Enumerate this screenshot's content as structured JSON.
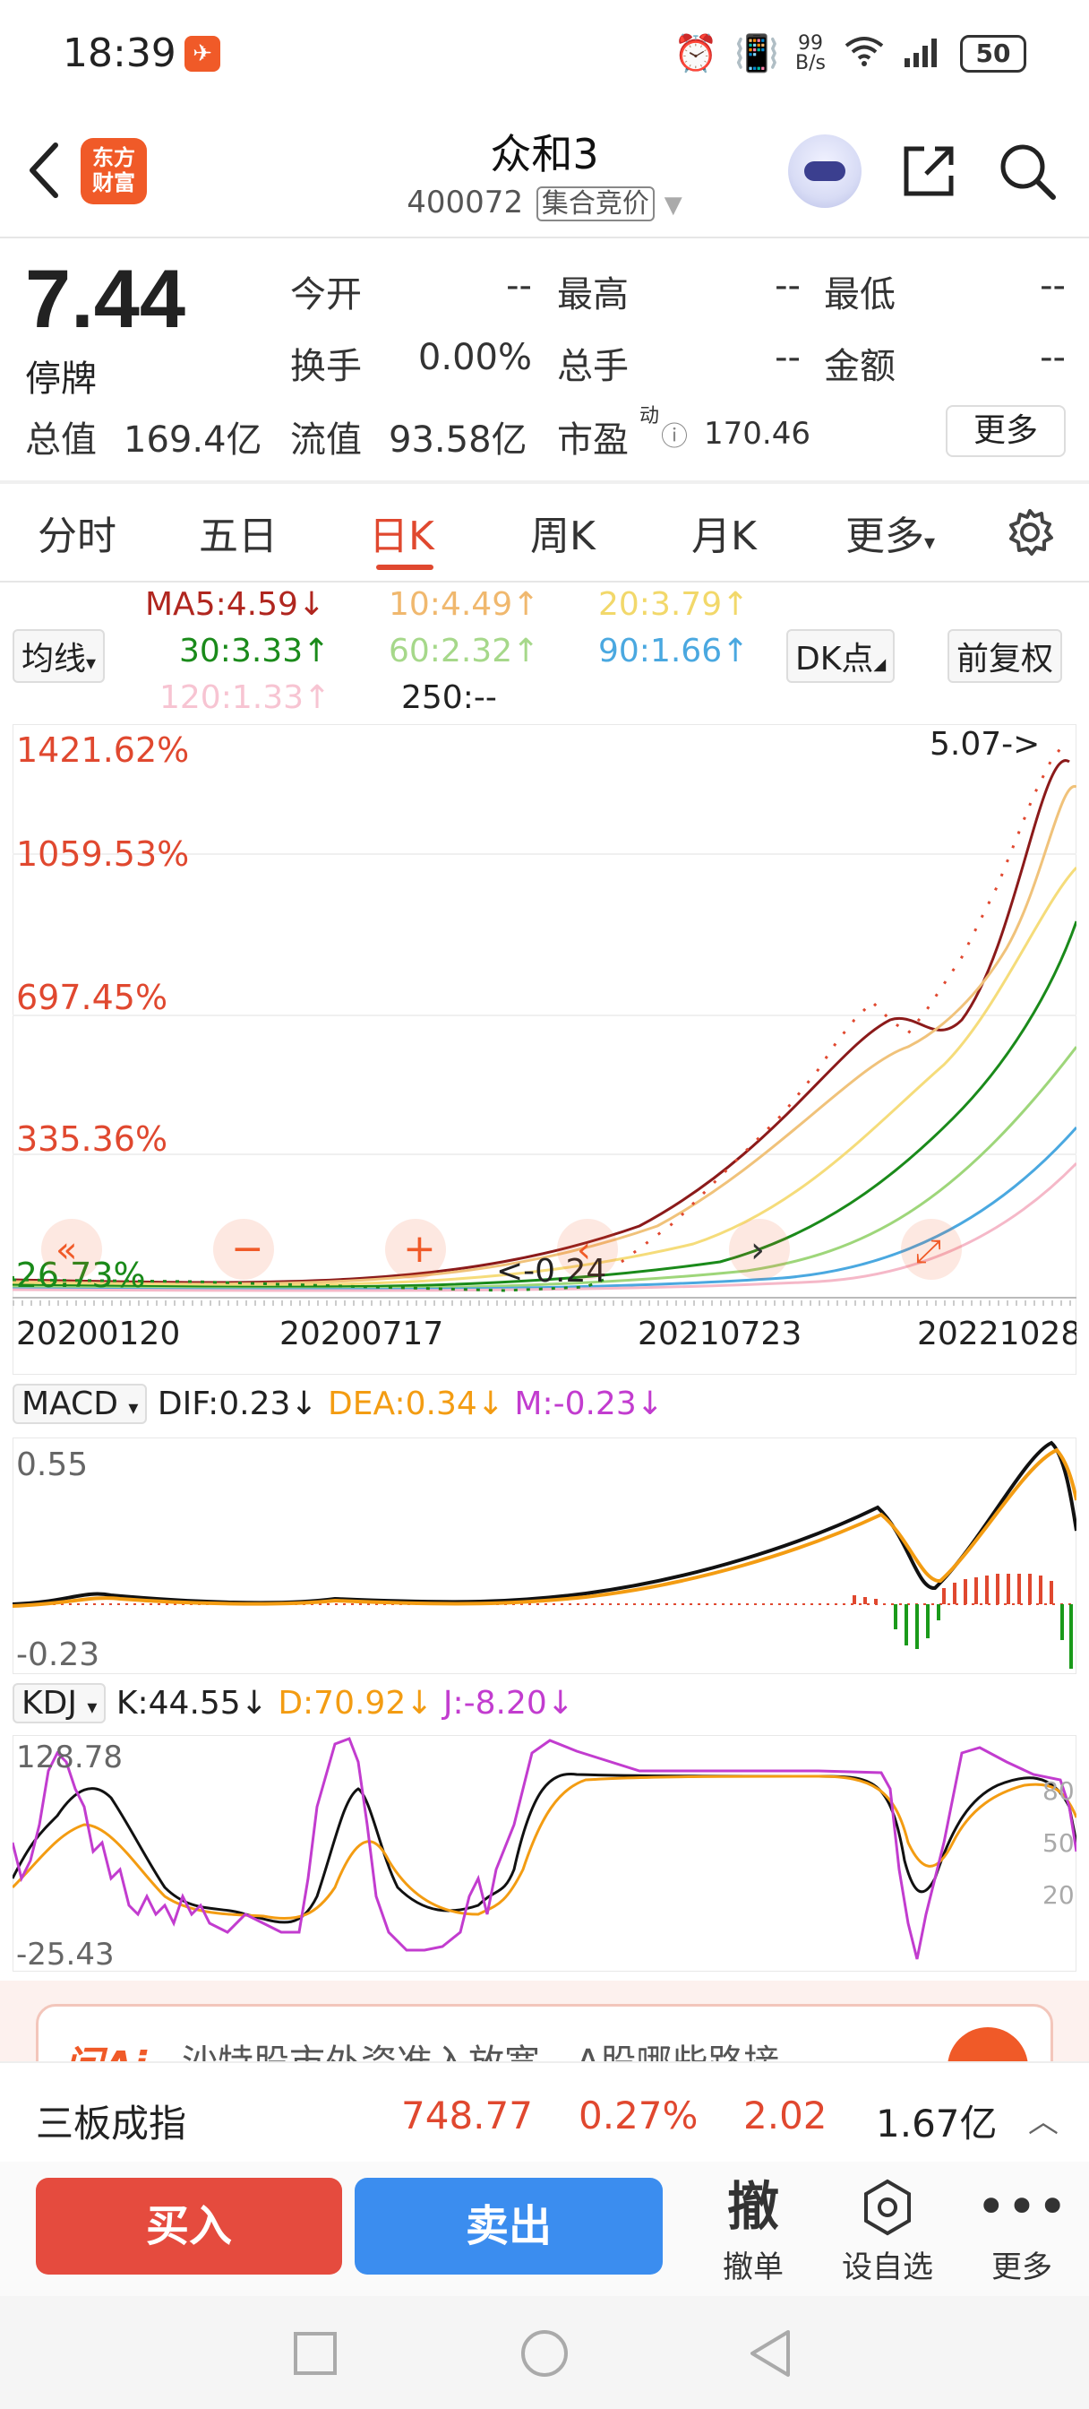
{
  "status_bar": {
    "time": "18:39",
    "net_speed_top": "99",
    "net_speed_bottom": "B/s",
    "battery": "50"
  },
  "header": {
    "stock_name": "众和3",
    "stock_code": "400072",
    "auction_tag": "集合竞价",
    "logo_text_line1": "东方",
    "logo_text_line2": "财富"
  },
  "quote": {
    "price": "7.44",
    "status": "停牌",
    "fields": [
      {
        "label": "今开",
        "value": "--"
      },
      {
        "label": "最高",
        "value": "--"
      },
      {
        "label": "最低",
        "value": "--"
      },
      {
        "label": "换手",
        "value": "0.00%"
      },
      {
        "label": "总手",
        "value": "--"
      },
      {
        "label": "金额",
        "value": "--"
      }
    ],
    "total_value_label": "总值",
    "total_value": "169.4亿",
    "float_value_label": "流值",
    "float_value": "93.58亿",
    "pe_label": "市盈",
    "pe_sup": "动",
    "pe_value": "170.46",
    "more_label": "更多"
  },
  "tabs": [
    {
      "label": "分时",
      "active": false
    },
    {
      "label": "五日",
      "active": false
    },
    {
      "label": "日K",
      "active": true
    },
    {
      "label": "周K",
      "active": false
    },
    {
      "label": "月K",
      "active": false
    },
    {
      "label": "更多",
      "active": false
    }
  ],
  "ma_labels": {
    "ma_button": "均线",
    "ma5": "MA5:4.59↓",
    "ma10": "10:4.49↑",
    "ma20": "20:3.79↑",
    "ma30": "30:3.33↑",
    "ma60": "60:2.32↑",
    "ma90": "90:1.66↑",
    "ma120": "120:1.33↑",
    "ma250": "250:--",
    "dk_button": "DK点",
    "fq_button": "前复权"
  },
  "colors": {
    "red": "#e0482f",
    "ma5": "#8b1a1a",
    "ma10": "#f0c27a",
    "ma20": "#f5dc7a",
    "ma30": "#1a8a1a",
    "ma60": "#9ed67a",
    "ma90": "#4aa8e0",
    "ma120": "#f5b8c8"
  },
  "main_chart": {
    "y_labels": [
      "1421.62%",
      "1059.53%",
      "697.45%",
      "335.36%",
      "-26.73%"
    ],
    "x_labels": [
      "20200120",
      "20200717",
      "20210723",
      "20221028"
    ],
    "high_annotation": "5.07->",
    "low_annotation": "<-0.24"
  },
  "macd": {
    "button": "MACD",
    "dif": "DIF:0.23↓",
    "dea": "DEA:0.34↓",
    "m": "M:-0.23↓",
    "y_top": "0.55",
    "y_bottom": "-0.23"
  },
  "kdj": {
    "button": "KDJ",
    "k": "K:44.55↓",
    "d": "D:70.92↓",
    "j": "J:-8.20↓",
    "y_top": "128.78",
    "y_bottom": "-25.43",
    "r80": "80",
    "r50": "50",
    "r20": "20"
  },
  "ai_banner": {
    "logo": "问Ai",
    "text": "沙特股市外资准入放宽，A股哪些路接"
  },
  "index_bar": {
    "name": "三板成指",
    "value": "748.77",
    "pct": "0.27%",
    "change": "2.02",
    "amount": "1.67亿"
  },
  "actions": {
    "buy": "买入",
    "sell": "卖出",
    "cancel_glyph": "撤",
    "cancel_label": "撤单",
    "watch_label": "设自选",
    "more_label": "更多"
  }
}
